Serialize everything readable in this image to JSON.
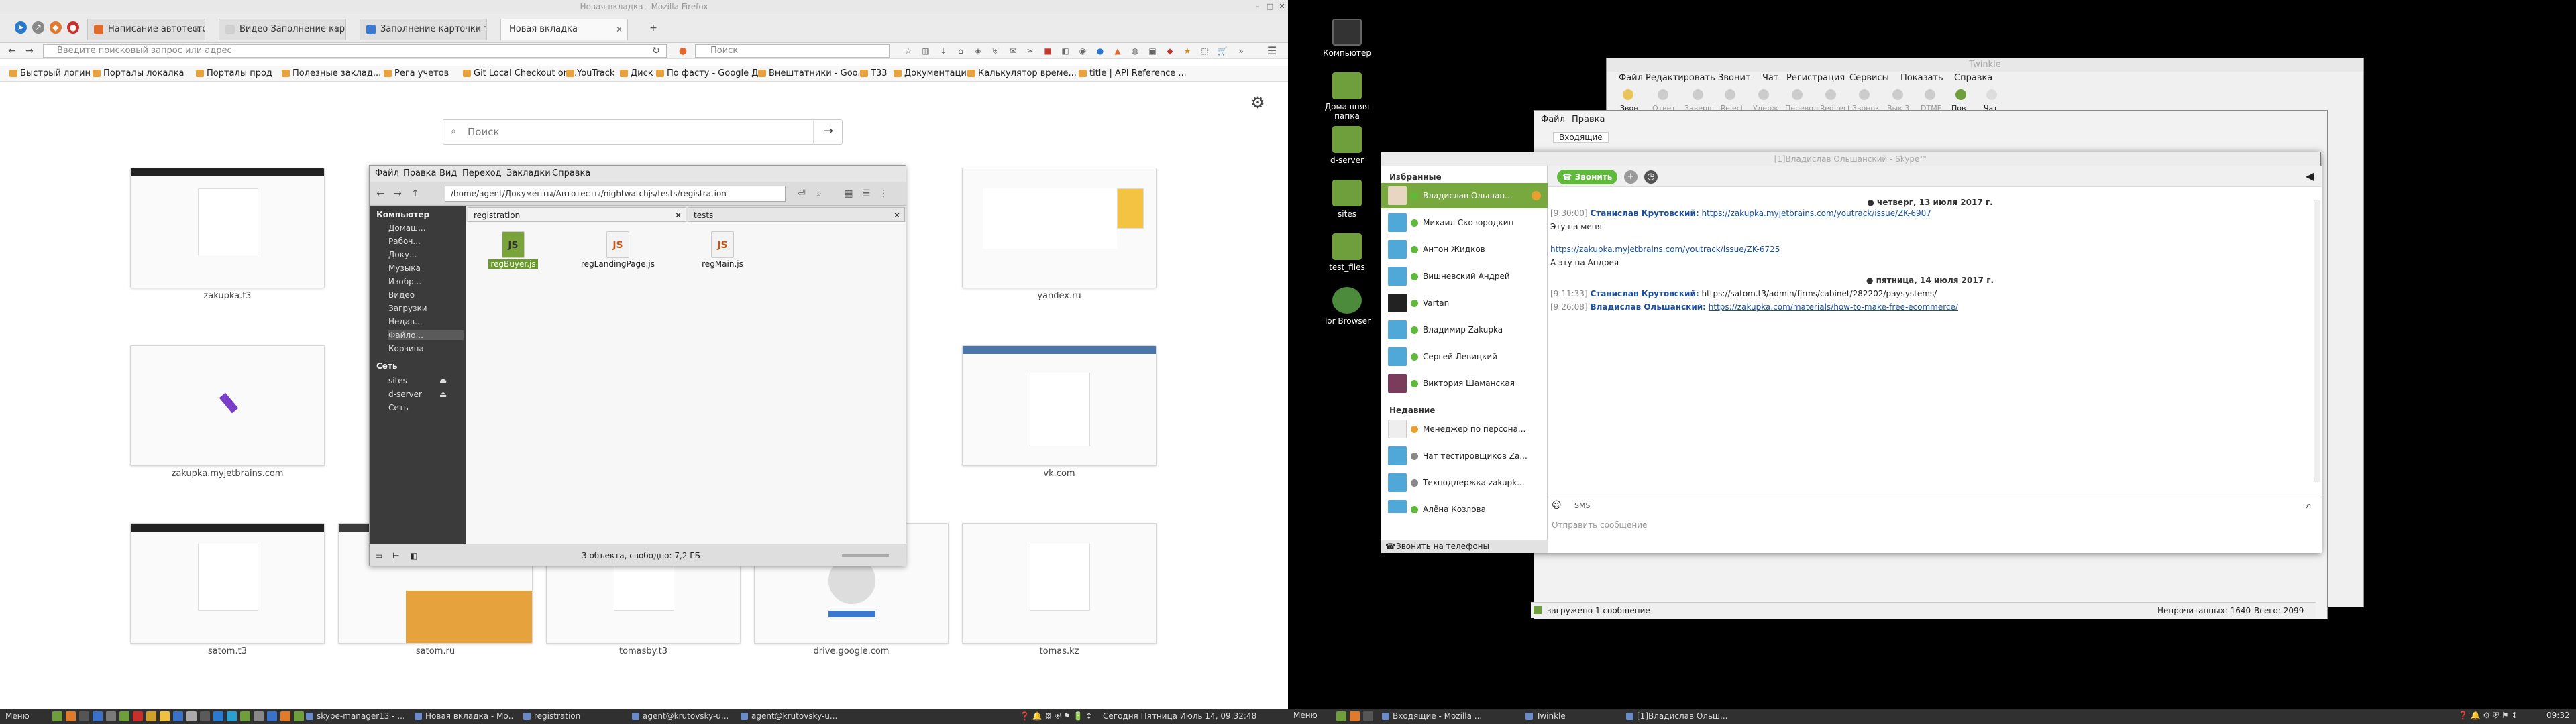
{
  "left": {
    "window_title": "Новая вкладка - Mozilla Firefox",
    "tabs": [
      {
        "label": "Написание автотестов (2",
        "fav": "#e06b2c"
      },
      {
        "label": "Видео Заполнение карточ",
        "fav": "#d0d0d0"
      },
      {
        "label": "Заполнение карточки тов",
        "fav": "#3c77d0"
      },
      {
        "label": "Новая вкладка",
        "fav": ""
      }
    ],
    "url_placeholder": "Введите поисковый запрос или адрес",
    "search_placeholder": "Поиск",
    "bookmarks": [
      "Быстрый логин",
      "Порталы локалка",
      "Порталы прод",
      "Полезные заклад...",
      "Рега учетов",
      "Git Local Checkout on...",
      "YouTrack",
      "Диск",
      "По фасту - Google Д...",
      "Внештатники - Goo...",
      "T33",
      "Документация",
      "Калькулятор време...",
      "title | API Reference ..."
    ],
    "newtab": {
      "search_placeholder": "Поиск",
      "tiles": [
        {
          "caption": "zakupka.t3"
        },
        {
          "caption": "yandex.ru"
        },
        {
          "caption": "zakupka.myjetbrains.com"
        },
        {
          "caption": "vk.com"
        },
        {
          "caption": "satom.t3"
        },
        {
          "caption": "satom.ru"
        },
        {
          "caption": "tomasby.t3"
        },
        {
          "caption": "drive.google.com"
        },
        {
          "caption": "tomas.kz"
        }
      ]
    },
    "file_manager": {
      "menu": [
        "Файл",
        "Правка",
        "Вид",
        "Переход",
        "Закладки",
        "Справка"
      ],
      "path": "/home/agent/Документы/Автотесты/nightwatchjs/tests/registration",
      "side_header_computer": "Компьютер",
      "side_items": [
        "Домаш...",
        "Рабоч...",
        "Доку...",
        "Музыка",
        "Изобр...",
        "Видео",
        "Загрузки",
        "Недав...",
        "Файло...",
        "Корзина"
      ],
      "side_header_network": "Сеть",
      "net_items": [
        "sites",
        "d-server",
        "Сеть"
      ],
      "tabs": [
        "registration",
        "tests"
      ],
      "files": [
        {
          "name": "regBuyer.js",
          "icon": "JS",
          "selected": true
        },
        {
          "name": "regLandingPage.js",
          "icon": "JS",
          "selected": false
        },
        {
          "name": "regMain.js",
          "icon": "JS",
          "selected": false
        }
      ],
      "status": "3 объекта, свободно: 7,2 ГБ"
    },
    "taskbar": {
      "menu": "Меню",
      "items": [
        "skype-manager13 - ...",
        "Новая вкладка - Мо...",
        "registration",
        "agent@krutovsky-u...",
        "agent@krutovsky-u..."
      ],
      "clock": "Сегодня Пятница Июль 14, 09:32:48"
    }
  },
  "right": {
    "desktop_icons": [
      "Компьютер",
      "Домашняя папка",
      "d-server",
      "sites",
      "test_files",
      "Tor Browser"
    ],
    "twinkle": {
      "title": "Twinkle",
      "menu": [
        "Файл",
        "Редактировать",
        "Звонит",
        "Чат",
        "Регистрация",
        "Сервисы",
        "Показать",
        "Справка"
      ],
      "tools": [
        "Звон",
        "Ответ",
        "Заверш",
        "Reject",
        "Удерж",
        "Перевод",
        "Redirect",
        "Звонок",
        "Вык 3",
        "DTMF",
        "Пов",
        "Чат"
      ]
    },
    "bg_window": {
      "menu": [
        "Файл",
        "Правка"
      ],
      "tab": "Входящие"
    },
    "skype": {
      "title": "[1]Владислав Ольшанский - Skype™",
      "favorites_header": "Избранные",
      "contacts": [
        "Владислав Ольшан...",
        "Михаил Сковородкин",
        "Антон Жидков",
        "Вишневский Андрей",
        "Vartan",
        "Владимир Zakupka",
        "Сергей Левицкий",
        "Виктория Шаманская"
      ],
      "recent_header": "Недавние",
      "recent": [
        "Менеджер по персона...",
        "Чат тестировщиков Za...",
        "Техподдержка zakupk...",
        "Алёна Козлова"
      ],
      "call_phones": "Звонить на телефоны",
      "call_button": "Звонить",
      "messages": {
        "date1": "четверг, 13 июля 2017 г.",
        "m1_time": "[9:30:00]",
        "m1_author": "Станислав Крутовский:",
        "m1_link": "https://zakupka.myjetbrains.com/youtrack/issue/ZK-6907",
        "m2_text": "Эту на меня",
        "m3_link": "https://zakupka.myjetbrains.com/youtrack/issue/ZK-6725",
        "m4_text": "А эту на Андрея",
        "date2": "пятница, 14 июля 2017 г.",
        "m5_time": "[9:11:33]",
        "m5_author": "Станислав Крутовский:",
        "m5_text": "https://satom.t3/admin/firms/cabinet/282202/paysystems/",
        "m6_time": "[9:26:08]",
        "m6_author": "Владислав Ольшанский:",
        "m6_link": "https://zakupka.com/materials/how-to-make-free-ecommerce/"
      },
      "sms": "SMS",
      "input_placeholder": "Отправить сообщение"
    },
    "status_bar": {
      "left": "загружено 1 сообщение",
      "unread": "Непрочитанных: 1640",
      "total": "Всего: 2099"
    },
    "taskbar": {
      "menu": "Меню",
      "items": [
        "Входящие - Mozilla ...",
        "Twinkle",
        "[1]Владислав Ольш..."
      ],
      "clock": "09:32"
    }
  },
  "colors": {
    "skype_green": "#78a93f",
    "call_green": "#5fb93a",
    "link_blue": "#1a4ea0",
    "taskbar": "#303030"
  }
}
